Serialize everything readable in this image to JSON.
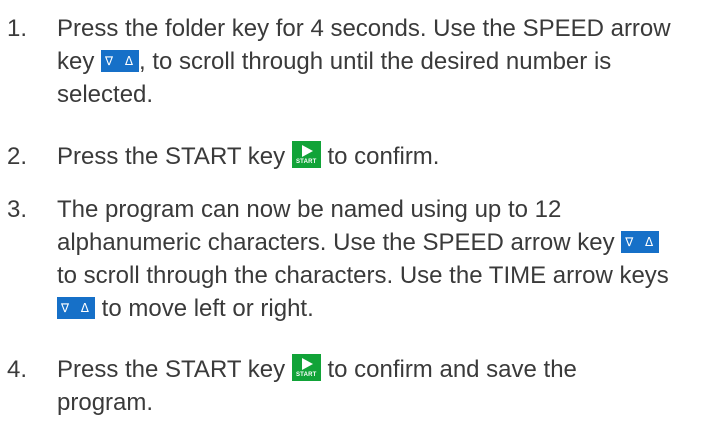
{
  "keys": {
    "speed_arrows": "∇ Δ",
    "time_arrows": "∇ Δ",
    "start_label": "START"
  },
  "steps": [
    {
      "number": "1.",
      "lines": [
        "Press the folder key for 4 seconds. Use the SPEED arrow",
        "key",
        ", to scroll through until the desired number is",
        "selected."
      ]
    },
    {
      "number": "2.",
      "lines": [
        "Press the START key",
        "to confirm."
      ]
    },
    {
      "number": "3.",
      "lines": [
        "The program can now be named using up to 12",
        "alphanumeric characters. Use the SPEED arrow key",
        "to scroll through the characters. Use the TIME arrow keys",
        "to move left or right."
      ]
    },
    {
      "number": "4.",
      "lines": [
        "Press the START key",
        "to confirm and save the",
        "program."
      ]
    }
  ]
}
